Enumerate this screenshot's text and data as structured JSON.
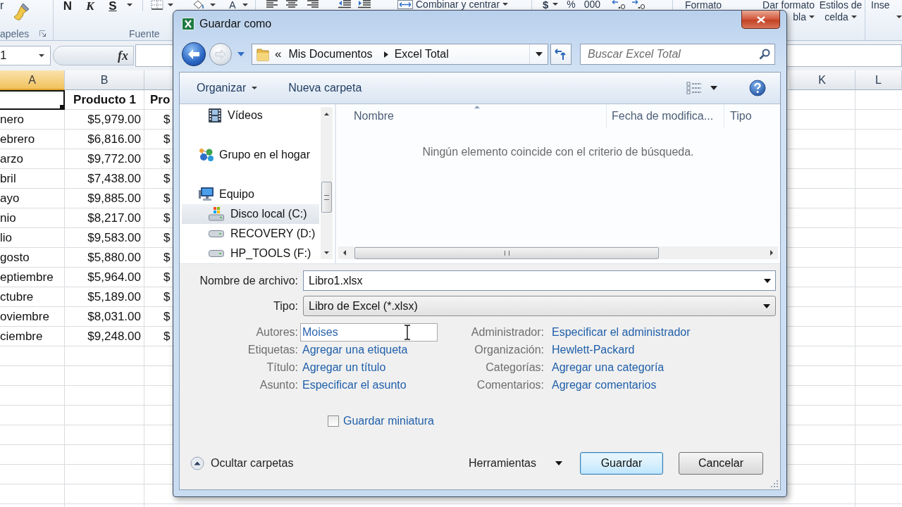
{
  "ribbon": {
    "fragment": "r",
    "font_buttons": [
      {
        "label": "N",
        "kind": "bold"
      },
      {
        "label": "K",
        "kind": "italic"
      },
      {
        "label": "S",
        "kind": "underline"
      }
    ],
    "font_color": "A",
    "merge": "Combinar y centrar",
    "number": [
      "$",
      "%",
      "000"
    ],
    "styles": [
      {
        "line_1": "Formato"
      },
      {
        "line_1": "Dar formato",
        "line_2": "bla"
      },
      {
        "line_1": "Estilos de",
        "line_2": "celda"
      }
    ],
    "cells": {
      "line_1": "Inse"
    },
    "groups": [
      "apeles",
      "Fuente"
    ]
  },
  "formula_bar": {
    "name_box": "1",
    "function_label": "fx"
  },
  "sheet": {
    "left_columns": [
      {
        "label": "A",
        "selected": true
      },
      {
        "label": "B",
        "selected": false
      }
    ],
    "right_columns": [
      {
        "label": "K",
        "selected": false
      },
      {
        "label": "L",
        "selected": false
      }
    ],
    "rows": [
      {
        "kind": "header",
        "a_selected": true,
        "b": "Producto 1",
        "c": "Pro"
      },
      {
        "kind": "data",
        "a_selected": false,
        "a": "nero",
        "b": "$5,979.00",
        "c": "$"
      },
      {
        "kind": "data",
        "a_selected": false,
        "a": "ebrero",
        "b": "$6,816.00",
        "c": "$"
      },
      {
        "kind": "data",
        "a_selected": false,
        "a": "arzo",
        "b": "$9,772.00",
        "c": "$"
      },
      {
        "kind": "data",
        "a_selected": false,
        "a": "bril",
        "b": "$7,438.00",
        "c": "$"
      },
      {
        "kind": "data",
        "a_selected": false,
        "a": "ayo",
        "b": "$9,885.00",
        "c": "$"
      },
      {
        "kind": "data",
        "a_selected": false,
        "a": "nio",
        "b": "$8,217.00",
        "c": "$"
      },
      {
        "kind": "data",
        "a_selected": false,
        "a": "lio",
        "b": "$9,583.00",
        "c": "$"
      },
      {
        "kind": "data",
        "a_selected": false,
        "a": "gosto",
        "b": "$5,880.00",
        "c": "$"
      },
      {
        "kind": "data",
        "a_selected": false,
        "a": "eptiembre",
        "b": "$5,964.00",
        "c": "$"
      },
      {
        "kind": "data",
        "a_selected": false,
        "a": "ctubre",
        "b": "$5,189.00",
        "c": "$"
      },
      {
        "kind": "data",
        "a_selected": false,
        "a": "oviembre",
        "b": "$8,031.00",
        "c": "$"
      },
      {
        "kind": "data",
        "a_selected": false,
        "a": "ciembre",
        "b": "$9,248.00",
        "c": "$"
      }
    ]
  },
  "dialog": {
    "title": "Guardar como",
    "address": {
      "overflow": "«",
      "path": [
        "Mis Documentos",
        "Excel Total"
      ]
    },
    "search": {
      "placeholder": "Buscar Excel Total"
    },
    "toolbar": {
      "organize": "Organizar",
      "new_folder": "Nueva carpeta"
    },
    "nav_tree": [
      {
        "children": [
          {
            "label": "Vídeos",
            "kind": "videos",
            "selected": false
          }
        ]
      },
      {
        "label": "Grupo en el hogar",
        "kind": "homegroup",
        "selected": false
      },
      {
        "label": "Equipo",
        "kind": "computer",
        "selected": false,
        "children": [
          {
            "label": "Disco local (C:)",
            "kind": "system_drive",
            "selected": true
          },
          {
            "label": "RECOVERY (D:)",
            "kind": "drive",
            "selected": false
          },
          {
            "label": "HP_TOOLS (F:)",
            "kind": "drive",
            "selected": false
          }
        ]
      }
    ],
    "file_columns": [
      {
        "label": "Nombre",
        "sorted": true
      },
      {
        "label": "Fecha de modifica...",
        "sorted": false
      },
      {
        "label": "Tipo",
        "sorted": false
      }
    ],
    "empty_message": "Ningún elemento coincide con el criterio de búsqueda.",
    "file_name": {
      "label": "Nombre de archivo:",
      "value": "Libro1.xlsx"
    },
    "file_type": {
      "label": "Tipo:",
      "value": "Libro de Excel (*.xlsx)"
    },
    "properties_left": [
      {
        "label": "Autores:",
        "value": "Moises",
        "kind": "field"
      },
      {
        "label": "Etiquetas:",
        "value": "Agregar una etiqueta",
        "kind": "link"
      },
      {
        "label": "Título:",
        "value": "Agregar un título",
        "kind": "link"
      },
      {
        "label": "Asunto:",
        "value": "Especificar el asunto",
        "kind": "link"
      }
    ],
    "properties_right": [
      {
        "label": "Administrador:",
        "value": "Especificar el administrador",
        "kind": "link"
      },
      {
        "label": "Organización:",
        "value": "Hewlett-Packard",
        "kind": "link"
      },
      {
        "label": "Categorías:",
        "value": "Agregar una categoría",
        "kind": "link"
      },
      {
        "label": "Comentarios:",
        "value": "Agregar comentarios",
        "kind": "link"
      }
    ],
    "thumbnail": {
      "label": "Guardar miniatura",
      "checked": false
    },
    "hide_folders": "Ocultar carpetas",
    "tools": "Herramientas",
    "buttons": [
      {
        "label": "Guardar",
        "default": true
      },
      {
        "label": "Cancelar",
        "default": false
      }
    ]
  }
}
